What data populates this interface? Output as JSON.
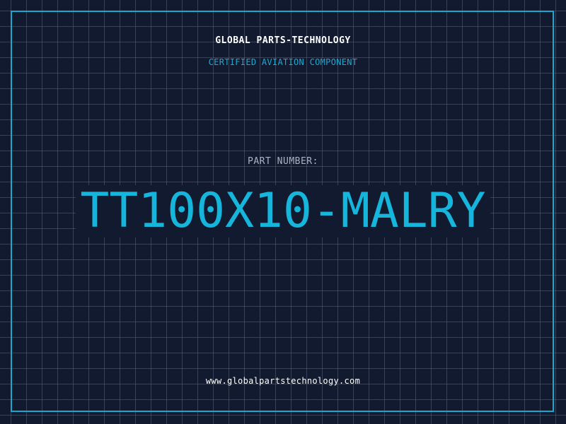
{
  "header": {
    "brand": "GLOBAL PARTS-TECHNOLOGY",
    "tagline": "CERTIFIED AVIATION COMPONENT"
  },
  "part": {
    "label": "PART NUMBER:",
    "number": "TT100X10-MALRY"
  },
  "footer": {
    "url": "www.globalpartstechnology.com"
  },
  "colors": {
    "background": "#111a2e",
    "accent": "#16b6dc",
    "frame": "#18a9cf",
    "label": "#aab3c5",
    "text": "#ffffff"
  }
}
